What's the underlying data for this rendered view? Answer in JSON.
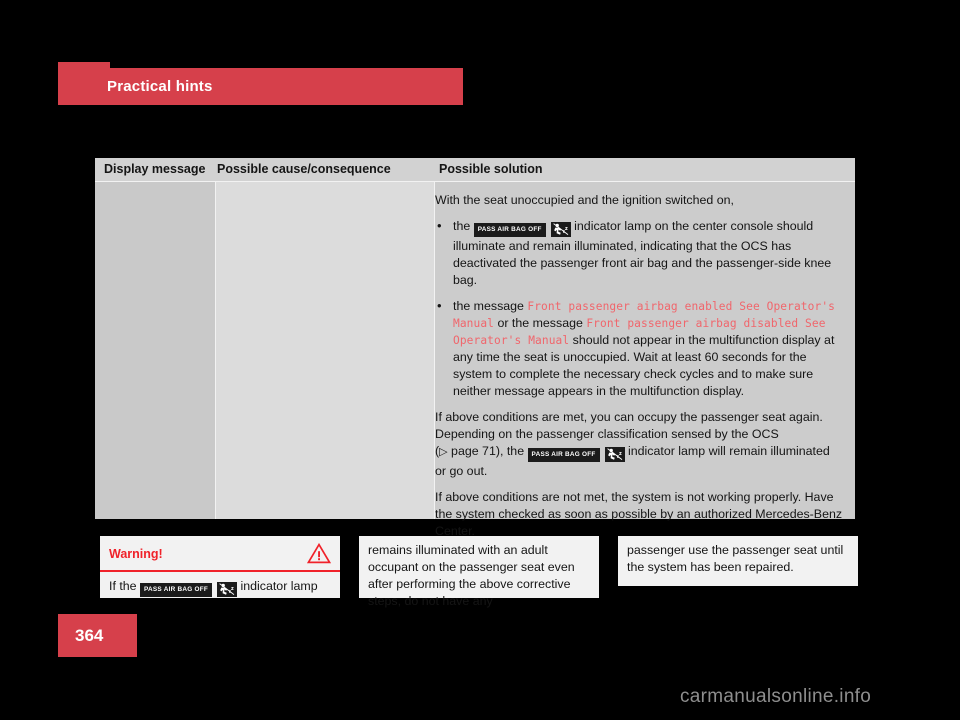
{
  "header": {
    "section_title": "Practical hints"
  },
  "table": {
    "columns": [
      {
        "header": "Display message"
      },
      {
        "header": "Possible cause/consequence"
      },
      {
        "header": "Possible solution"
      }
    ],
    "solution": {
      "intro": "With the seat unoccupied and the ignition switched on,",
      "bullets": [
        {
          "before_lamp": "the",
          "after_lamp": "indicator lamp on the center console should illuminate and remain illuminated, indicating that the OCS  has deactivated the passenger front air bag and the passenger-side knee bag."
        },
        {
          "part1": "the message ",
          "code1": "Front passenger airbag enabled See Operator's Manual",
          "part2": " or the message ",
          "code2": "Front passenger airbag disabled See Operator's Manual",
          "part3": " should not appear in the multifunction display at any time the seat is unoccupied. Wait at least 60 seconds for the system to complete the necessary check cycles and to make sure neither message appears in the multifunction display."
        }
      ],
      "para2_before": "If above conditions are met, you can occupy the passenger seat again. Depending on the passenger classification sensed by the OCS (",
      "para2_pageref_arrow": "▷",
      "para2_pageref": " page 71",
      "para2_after": "), the",
      "para2_end": "indicator lamp will remain illuminated or go out.",
      "para3": "If above conditions are not met, the system is not working properly. Have the system checked as soon as possible by an authorized Mercedes-Benz Center."
    }
  },
  "lamp": {
    "label": "PASS AIR BAG OFF",
    "glyph_name": "airbag-off-symbol"
  },
  "warning_box": {
    "title": "Warning!",
    "icon": "warning-triangle-icon",
    "body_before_lamp": "If the",
    "body_after_lamp": "indicator lamp"
  },
  "continuation_boxes": [
    {
      "text": "remains illuminated with an adult occupant on the passenger seat even after performing the above corrective steps, do not have any"
    },
    {
      "text": "passenger use the passenger seat until the system has been repaired."
    }
  ],
  "footer": {
    "page_number": "364",
    "watermark": "carmanualsonline.info"
  },
  "colors": {
    "accent_red": "#d6404b",
    "warning_red": "#f0222a",
    "code_red": "#f0666c",
    "table_bg": "#dcdcdc",
    "col1_bg": "#c9c9c9",
    "col3_bg": "#cccccc"
  }
}
